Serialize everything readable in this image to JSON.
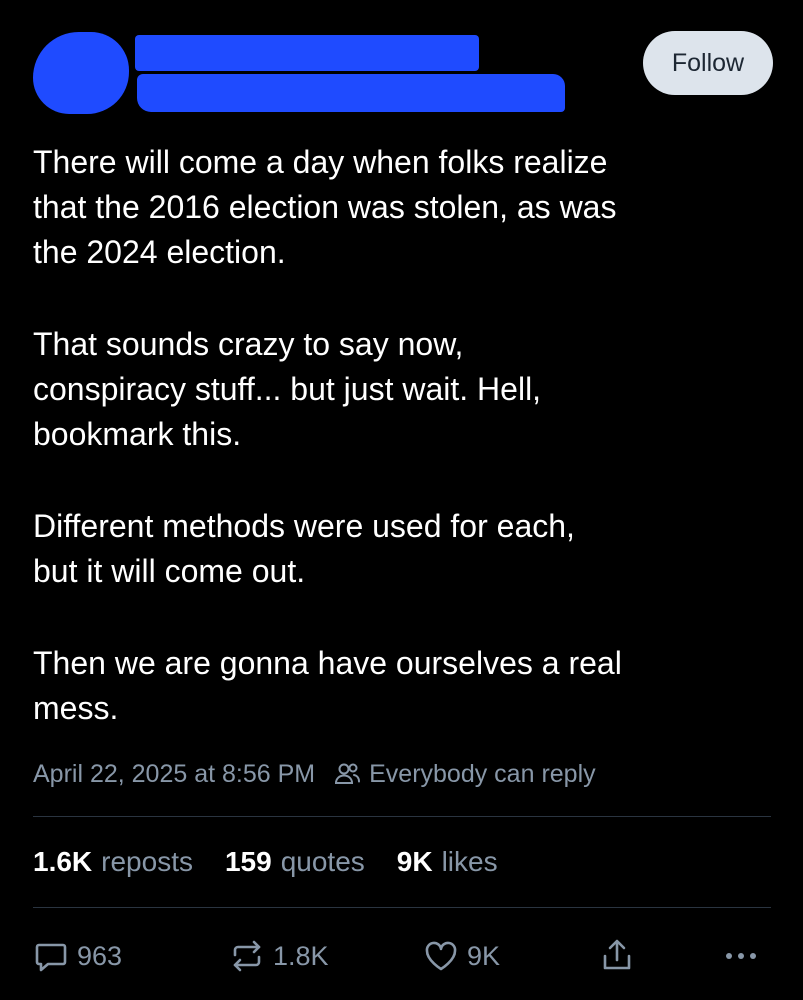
{
  "post": {
    "follow_label": "Follow",
    "paragraphs": [
      "There will come a day when folks realize\nthat the 2016 election was stolen, as was\nthe 2024 election.",
      "That sounds crazy to say now,\nconspiracy stuff... but just wait. Hell,\nbookmark this.",
      "Different methods were used for each,\nbut it will come out.",
      "Then we are gonna have ourselves a real\nmess."
    ],
    "timestamp": "April 22, 2025 at 8:56 PM",
    "reply_setting": "Everybody can reply"
  },
  "stats": {
    "reposts": {
      "count": "1.6K",
      "label": "reposts"
    },
    "quotes": {
      "count": "159",
      "label": "quotes"
    },
    "likes": {
      "count": "9K",
      "label": "likes"
    }
  },
  "actions": {
    "reply_count": "963",
    "repost_count": "1.8K",
    "like_count": "9K"
  },
  "icons": {
    "reply": "speech-bubble-icon",
    "repost": "repost-arrows-icon",
    "like": "heart-icon",
    "share": "share-upload-icon",
    "more": "ellipsis-icon",
    "reply_setting": "people-icon"
  },
  "colors": {
    "background": "#000000",
    "text": "#ffffff",
    "muted": "#8897a8",
    "follow_bg": "#dde4ec",
    "redaction": "#1f4bff"
  }
}
